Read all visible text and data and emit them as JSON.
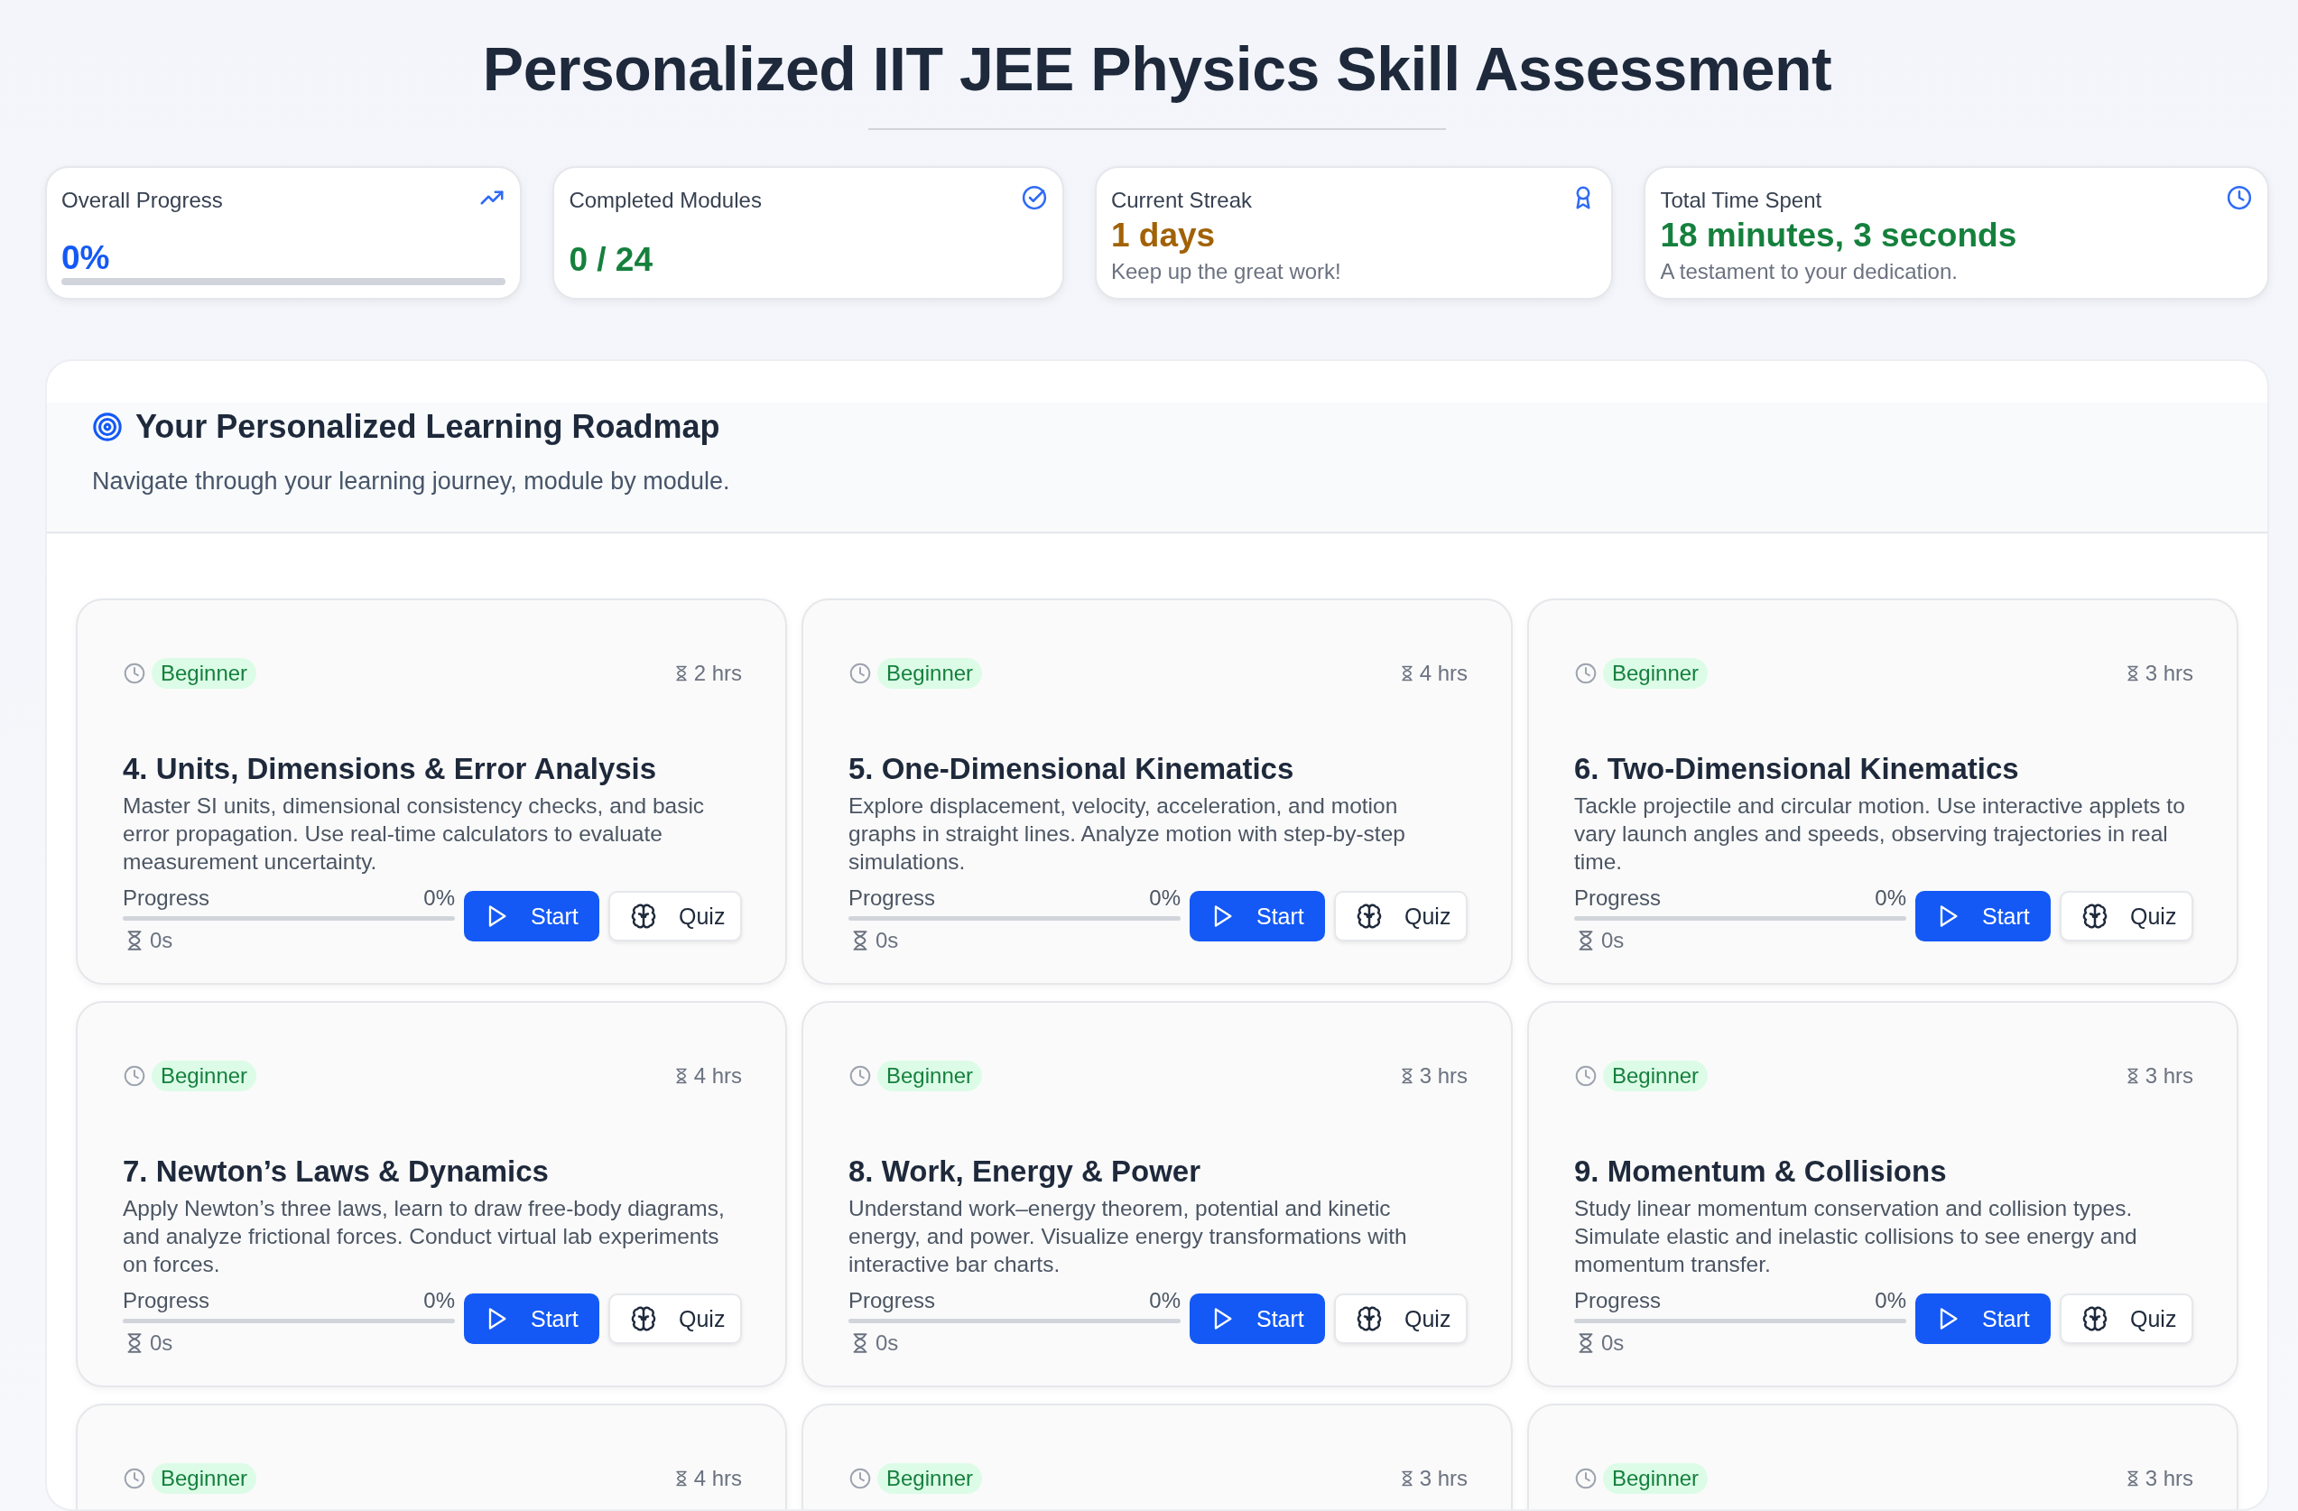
{
  "page": {
    "title": "Personalized IIT JEE Physics Skill Assessment"
  },
  "stats": [
    {
      "kind": "progress",
      "label": "Overall Progress",
      "value": "0%",
      "level": 0,
      "color": "#1459f5"
    },
    {
      "kind": "value",
      "label": "Completed Modules",
      "value": "0 / 24",
      "color": "#15803d"
    },
    {
      "kind": "caption",
      "label": "Current Streak",
      "value": "1 days",
      "caption": "Keep up the great work!",
      "color": "#a16207"
    },
    {
      "kind": "caption",
      "label": "Total Time Spent",
      "value": "18 minutes, 3 seconds",
      "caption": "A testament to your dedication.",
      "color": "#15803d"
    }
  ],
  "roadmap": {
    "title": "Your Personalized Learning Roadmap",
    "subtitle": "Navigate through your learning journey, module by module.",
    "modules": [
      {
        "difficulty": "Beginner",
        "duration": "2 hrs",
        "title": "4. Units, Dimensions & Error Analysis",
        "description": "Master SI units, dimensional consistency checks, and basic error propagation. Use real-time calculators to evaluate measurement uncertainty.",
        "progress_label": "Progress",
        "progress_value": "0%",
        "level": 0,
        "time_spent": "0s",
        "start": "Start",
        "quiz": "Quiz"
      },
      {
        "difficulty": "Beginner",
        "duration": "4 hrs",
        "title": "5. One-Dimensional Kinematics",
        "description": "Explore displacement, velocity, acceleration, and motion graphs in straight lines. Analyze motion with step-by-step simulations.",
        "progress_label": "Progress",
        "progress_value": "0%",
        "level": 0,
        "time_spent": "0s",
        "start": "Start",
        "quiz": "Quiz"
      },
      {
        "difficulty": "Beginner",
        "duration": "3 hrs",
        "title": "6. Two-Dimensional Kinematics",
        "description": "Tackle projectile and circular motion. Use interactive applets to vary launch angles and speeds, observing trajectories in real time.",
        "progress_label": "Progress",
        "progress_value": "0%",
        "level": 0,
        "time_spent": "0s",
        "start": "Start",
        "quiz": "Quiz"
      },
      {
        "difficulty": "Beginner",
        "duration": "4 hrs",
        "title": "7. Newton’s Laws & Dynamics",
        "description": "Apply Newton’s three laws, learn to draw free-body diagrams, and analyze frictional forces. Conduct virtual lab experiments on forces.",
        "progress_label": "Progress",
        "progress_value": "0%",
        "level": 0,
        "time_spent": "0s",
        "start": "Start",
        "quiz": "Quiz"
      },
      {
        "difficulty": "Beginner",
        "duration": "3 hrs",
        "title": "8. Work, Energy & Power",
        "description": "Understand work–energy theorem, potential and kinetic energy, and power. Visualize energy transformations with interactive bar charts.",
        "progress_label": "Progress",
        "progress_value": "0%",
        "level": 0,
        "time_spent": "0s",
        "start": "Start",
        "quiz": "Quiz"
      },
      {
        "difficulty": "Beginner",
        "duration": "3 hrs",
        "title": "9. Momentum & Collisions",
        "description": "Study linear momentum conservation and collision types. Simulate elastic and inelastic collisions to see energy and momentum transfer.",
        "progress_label": "Progress",
        "progress_value": "0%",
        "level": 0,
        "time_spent": "0s",
        "start": "Start",
        "quiz": "Quiz"
      },
      {
        "difficulty": "Beginner",
        "duration": "4 hrs"
      },
      {
        "difficulty": "Beginner",
        "duration": "3 hrs"
      },
      {
        "difficulty": "Beginner",
        "duration": "3 hrs"
      }
    ]
  }
}
